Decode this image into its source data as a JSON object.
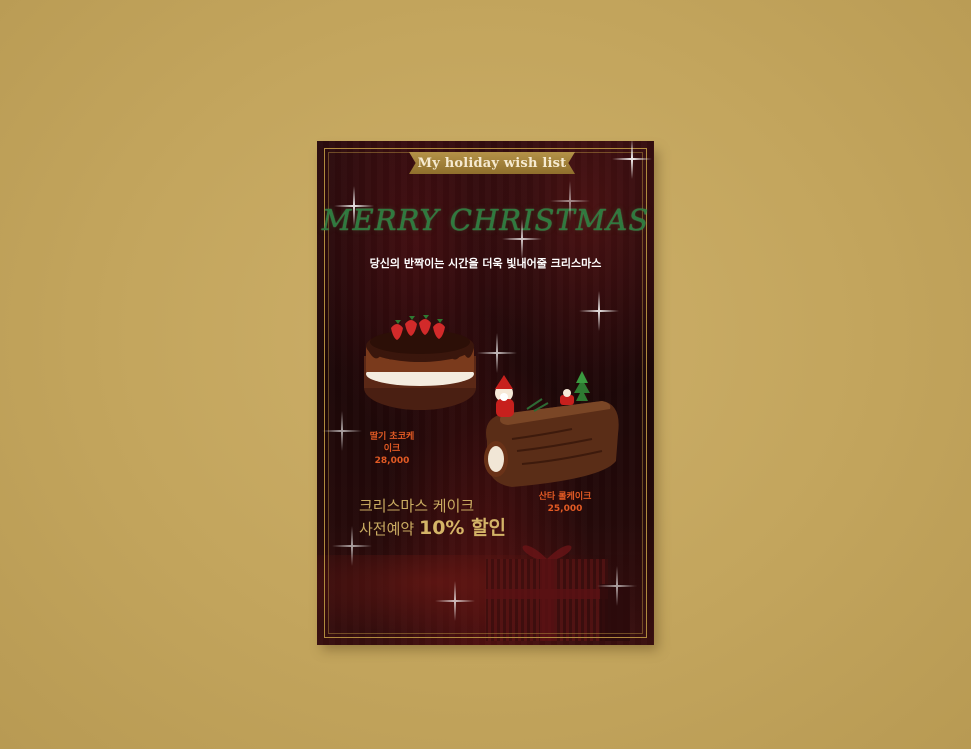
{
  "poster": {
    "ribbon_text": "My holiday wish list",
    "title": "MERRY CHRISTMAS",
    "subtitle": "당신의 반짝이는 시간을 더욱 빛내어줄 크리스마스",
    "products": [
      {
        "name": "딸기 초코케이크",
        "price": "28,000"
      },
      {
        "name": "산타 롤케이크",
        "price": "25,000"
      }
    ],
    "promo": {
      "line1": "크리스마스 케이크",
      "line2_prefix": "사전예약",
      "line2_highlight": "10% 할인"
    }
  },
  "colors": {
    "background": "#c4a65e",
    "poster_bg": "#1c0708",
    "title_green": "#2f7a3f",
    "label_orange": "#e25a24",
    "gold": "#c9ab61"
  },
  "icons": [
    "sparkle-icon",
    "gift-box-icon",
    "strawberry-cake-icon",
    "santa-roll-cake-icon"
  ]
}
